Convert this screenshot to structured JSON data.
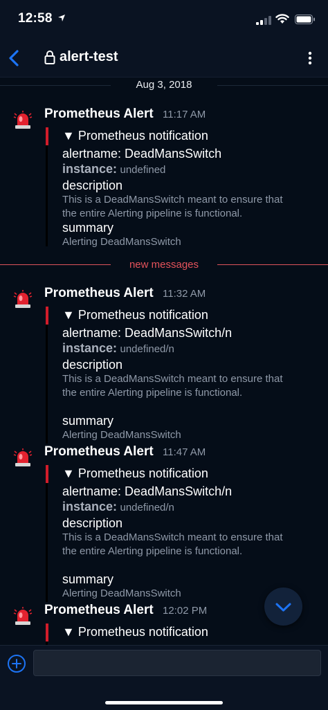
{
  "status_bar": {
    "time": "12:58"
  },
  "nav": {
    "channel_name": "alert-test"
  },
  "dividers": {
    "date": "Aug 3, 2018",
    "new_messages": "new messages"
  },
  "messages": [
    {
      "sender": "Prometheus Alert",
      "time": "11:17 AM",
      "title": "▼ Prometheus notification",
      "alertname": "alertname: DeadMansSwitch",
      "instance_key": "instance:",
      "instance_value": "undefined",
      "description_key": "description",
      "description_line1": "This is a DeadMansSwitch meant to ensure that",
      "description_line2": "the entire Alerting pipeline is functional.",
      "summary_key": "summary",
      "summary_value": "Alerting DeadMansSwitch"
    },
    {
      "sender": "Prometheus Alert",
      "time": "11:32 AM",
      "title": "▼ Prometheus notification",
      "alertname": "alertname: DeadMansSwitch/n",
      "instance_key": "instance:",
      "instance_value": "undefined/n",
      "description_key": "description",
      "description_line1": "This is a DeadMansSwitch meant to ensure that",
      "description_line2": "the entire Alerting pipeline is functional.",
      "summary_key": "summary",
      "summary_value": "Alerting DeadMansSwitch"
    },
    {
      "sender": "Prometheus Alert",
      "time": "11:47 AM",
      "title": "▼ Prometheus notification",
      "alertname": "alertname: DeadMansSwitch/n",
      "instance_key": "instance:",
      "instance_value": "undefined/n",
      "description_key": "description",
      "description_line1": "This is a DeadMansSwitch meant to ensure that",
      "description_line2": "the entire Alerting pipeline is functional.",
      "summary_key": "summary",
      "summary_value": "Alerting DeadMansSwitch"
    },
    {
      "sender": "Prometheus Alert",
      "time": "12:02 PM",
      "title": "▼ Prometheus notification"
    }
  ],
  "icons": {
    "avatar": "rotating-siren-emoji",
    "back": "chevron-left-icon",
    "lock": "lock-icon",
    "more": "kebab-menu-icon",
    "scroll": "chevron-down-icon",
    "add": "plus-circle-icon"
  },
  "colors": {
    "accent": "#1d74f5",
    "new_messages": "#e5535b",
    "attachment_stripe": "#d11c2a"
  }
}
